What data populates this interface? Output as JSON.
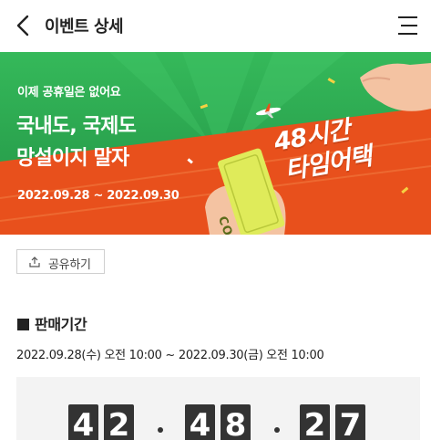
{
  "header": {
    "title": "이벤트 상세",
    "back_icon": "chevron-left-icon",
    "menu_icon": "hamburger-menu-icon"
  },
  "banner": {
    "subtitle": "이제 공휴일은 없어요",
    "title_line1": "국내도, 국제도",
    "title_line2": "망설이지 말자",
    "date_range": "2022.09.28 ~ 2022.09.30",
    "headline_line1": "48시간",
    "headline_line2": "타임어택",
    "coupon_label": "COUPON",
    "colors": {
      "green": "#2ea84f",
      "orange": "#e8501c"
    }
  },
  "share": {
    "label": "공유하기",
    "icon": "upload-share-icon"
  },
  "sale_period": {
    "heading": "판매기간",
    "text": "2022.09.28(수) 오전 10:00 ~ 2022.09.30(금) 오전 10:00"
  },
  "countdown": {
    "hours": [
      "4",
      "2"
    ],
    "minutes": [
      "4",
      "8"
    ],
    "seconds": [
      "2",
      "7"
    ]
  }
}
